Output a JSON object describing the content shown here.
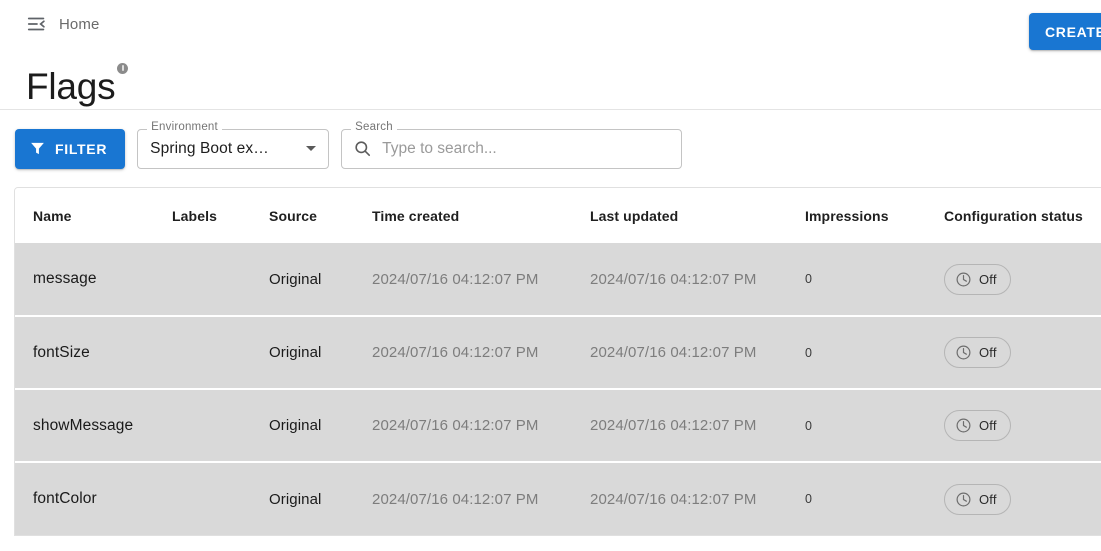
{
  "header": {
    "menu_icon": "menu-collapse-icon",
    "breadcrumb": "Home",
    "title": "Flags",
    "title_badge_icon": "info-badge-icon",
    "create_label": "CREATE"
  },
  "toolbar": {
    "filter_label": "FILTER",
    "filter_icon": "funnel-icon",
    "environment": {
      "label": "Environment",
      "value": "Spring Boot ex…",
      "caret_icon": "chevron-down-icon"
    },
    "search": {
      "label": "Search",
      "placeholder": "Type to search...",
      "value": "",
      "icon": "search-icon"
    }
  },
  "table": {
    "columns": [
      "Name",
      "Labels",
      "Source",
      "Time created",
      "Last updated",
      "Impressions",
      "Configuration status"
    ],
    "rows": [
      {
        "name": "message",
        "labels": "",
        "source": "Original",
        "time_created": "2024/07/16 04:12:07 PM",
        "last_updated": "2024/07/16 04:12:07 PM",
        "impressions": "0",
        "status": "Off",
        "status_icon": "clock-icon"
      },
      {
        "name": "fontSize",
        "labels": "",
        "source": "Original",
        "time_created": "2024/07/16 04:12:07 PM",
        "last_updated": "2024/07/16 04:12:07 PM",
        "impressions": "0",
        "status": "Off",
        "status_icon": "clock-icon"
      },
      {
        "name": "showMessage",
        "labels": "",
        "source": "Original",
        "time_created": "2024/07/16 04:12:07 PM",
        "last_updated": "2024/07/16 04:12:07 PM",
        "impressions": "0",
        "status": "Off",
        "status_icon": "clock-icon"
      },
      {
        "name": "fontColor",
        "labels": "",
        "source": "Original",
        "time_created": "2024/07/16 04:12:07 PM",
        "last_updated": "2024/07/16 04:12:07 PM",
        "impressions": "0",
        "status": "Off",
        "status_icon": "clock-icon"
      }
    ]
  },
  "colors": {
    "primary": "#1976d2",
    "row_background": "#d9d9d9",
    "muted_text": "#7d7d7d"
  }
}
